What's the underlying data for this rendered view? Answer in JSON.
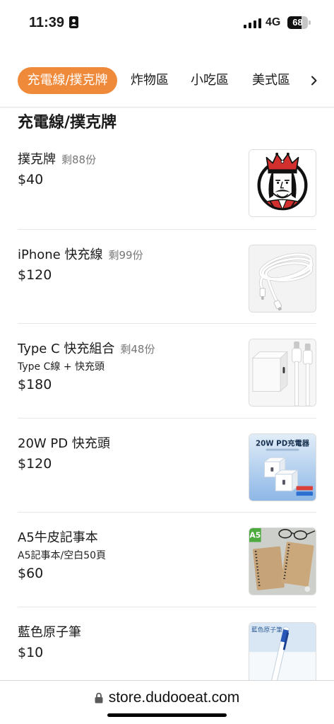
{
  "status_bar": {
    "time": "11:39",
    "focus_icon": "person-badge-icon",
    "signal_icon": "signal-bars-icon",
    "network": "4G",
    "battery": "68",
    "battery_level": 0.68
  },
  "category_tabs": {
    "items": [
      {
        "label": "充電線/撲克牌",
        "active": true
      },
      {
        "label": "炸物區",
        "active": false
      },
      {
        "label": "小吃區",
        "active": false
      },
      {
        "label": "美式區",
        "active": false
      }
    ],
    "more_icon": "chevron-right-icon"
  },
  "section": {
    "title": "充電線/撲克牌"
  },
  "products": [
    {
      "name": "撲克牌",
      "stock": "剩88份",
      "price": "$40",
      "image_icon": "king-playing-card-image"
    },
    {
      "name": "iPhone 快充線",
      "stock": "剩99份",
      "price": "$120",
      "image_icon": "white-charging-cable-image"
    },
    {
      "name": "Type C 快充組合",
      "stock": "剩48份",
      "description": "Type C線 + 快充頭",
      "price": "$180",
      "image_icon": "charger-and-cables-image"
    },
    {
      "name": "20W PD 快充頭",
      "price": "$120",
      "image_icon": "pd-charger-image",
      "image_text": "20W PD充電器"
    },
    {
      "name": "A5牛皮記事本",
      "description": "A5記事本/空白50頁",
      "price": "$60",
      "image_icon": "kraft-notebook-image",
      "image_text": "A5"
    },
    {
      "name": "藍色原子筆",
      "price": "$10",
      "image_icon": "blue-pen-image",
      "image_text": "藍色原子筆"
    }
  ],
  "browser_bar": {
    "lock_icon": "lock-icon",
    "url": "store.dudooeat.com"
  },
  "colors": {
    "accent": "#f08a3b",
    "text_secondary": "#777777"
  }
}
